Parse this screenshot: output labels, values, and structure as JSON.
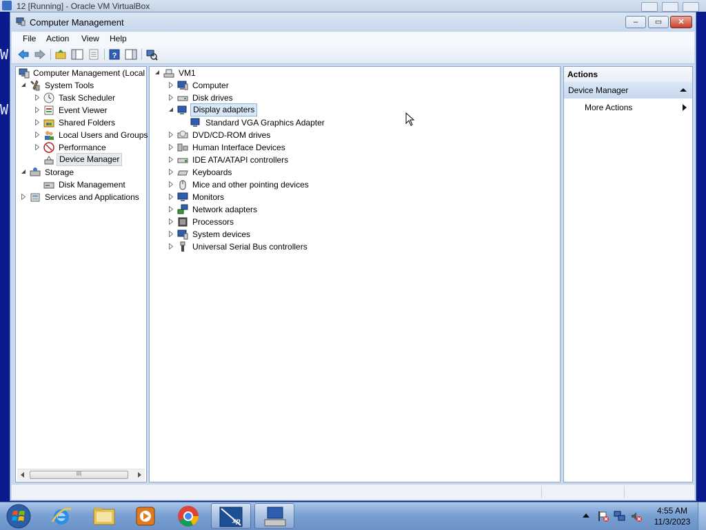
{
  "vbox": {
    "title": "12 [Running] - Oracle VM VirtualBox"
  },
  "background_text": "W",
  "window": {
    "title": "Computer Management",
    "controls": {
      "minimize": "–",
      "maximize": "▭",
      "close": "✕"
    }
  },
  "menu": [
    "File",
    "Action",
    "View",
    "Help"
  ],
  "tree": {
    "root": "Computer Management (Local",
    "items": [
      {
        "label": "System Tools",
        "expanded": true
      },
      {
        "label": "Task Scheduler"
      },
      {
        "label": "Event Viewer"
      },
      {
        "label": "Shared Folders"
      },
      {
        "label": "Local Users and Groups"
      },
      {
        "label": "Performance"
      },
      {
        "label": "Device Manager",
        "selected": true
      },
      {
        "label": "Storage",
        "expanded": true
      },
      {
        "label": "Disk Management"
      },
      {
        "label": "Services and Applications"
      }
    ],
    "hscroll_grip": "III"
  },
  "devices": {
    "root": "VM1",
    "items": [
      {
        "label": "Computer"
      },
      {
        "label": "Disk drives"
      },
      {
        "label": "Display adapters",
        "expanded": true,
        "highlighted": true
      },
      {
        "label": "Standard VGA Graphics Adapter",
        "child": true
      },
      {
        "label": "DVD/CD-ROM drives"
      },
      {
        "label": "Human Interface Devices"
      },
      {
        "label": "IDE ATA/ATAPI controllers"
      },
      {
        "label": "Keyboards"
      },
      {
        "label": "Mice and other pointing devices"
      },
      {
        "label": "Monitors"
      },
      {
        "label": "Network adapters"
      },
      {
        "label": "Processors"
      },
      {
        "label": "System devices"
      },
      {
        "label": "Universal Serial Bus controllers"
      }
    ]
  },
  "actions": {
    "header": "Actions",
    "section": "Device Manager",
    "more": "More Actions"
  },
  "taskbar": {
    "apps": [
      "windows-start",
      "internet-explorer",
      "file-explorer",
      "media-player",
      "chrome",
      "xp-mode",
      "computer-management"
    ],
    "xp_label": "xp",
    "clock": {
      "time": "4:55 AM",
      "date": "11/3/2023"
    }
  },
  "colors": {
    "accent": "#c7d9f0",
    "desktop": "#0b1a8c",
    "taskbar": "#7aa1d3"
  }
}
